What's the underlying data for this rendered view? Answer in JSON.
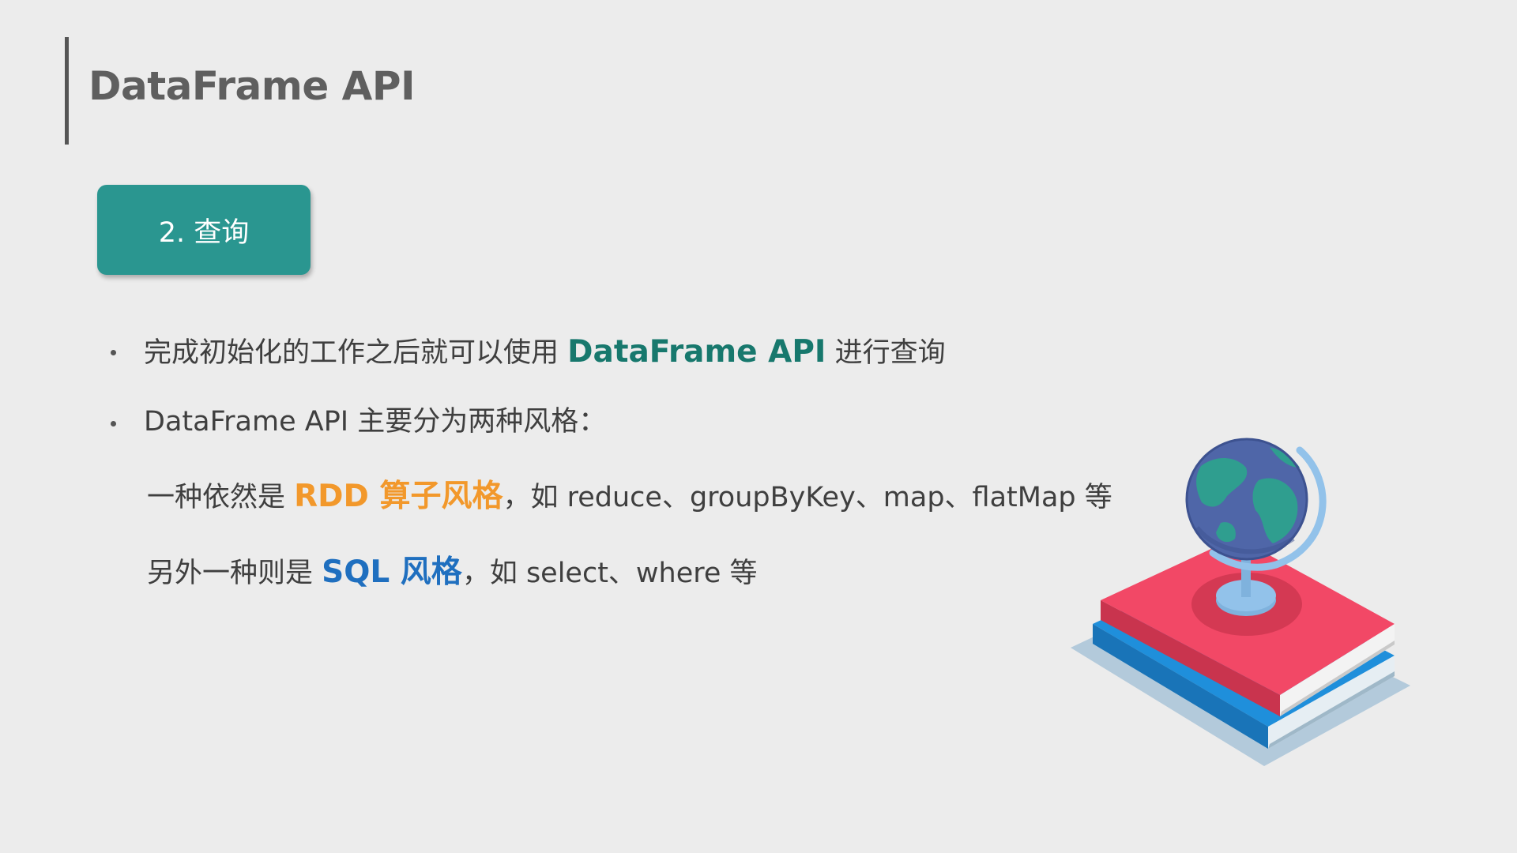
{
  "slide": {
    "title": "DataFrame API",
    "section_label": "2. 查询"
  },
  "bullets": [
    {
      "pre": "完成初始化的工作之后就可以使用 ",
      "highlight": "DataFrame API",
      "post": " 进行查询"
    },
    {
      "text": "DataFrame API 主要分为两种风格："
    }
  ],
  "sublines": [
    {
      "pre": "一种依然是 ",
      "highlight": "RDD 算子风格",
      "post": "，如 reduce、groupByKey、map、flatMap 等"
    },
    {
      "pre": "另外一种则是 ",
      "highlight": "SQL 风格",
      "post": "，如 select、where 等"
    }
  ],
  "colors": {
    "badge": "#2a9690",
    "highlight_green": "#17786d",
    "highlight_orange": "#f2982b",
    "highlight_blue": "#1f6fbf",
    "book_red": "#f24866",
    "book_blue": "#1f8fdb",
    "globe_ocean": "#4f66a8",
    "globe_land": "#2f9e8f"
  },
  "illustration": {
    "icon": "globe-on-books-icon"
  }
}
